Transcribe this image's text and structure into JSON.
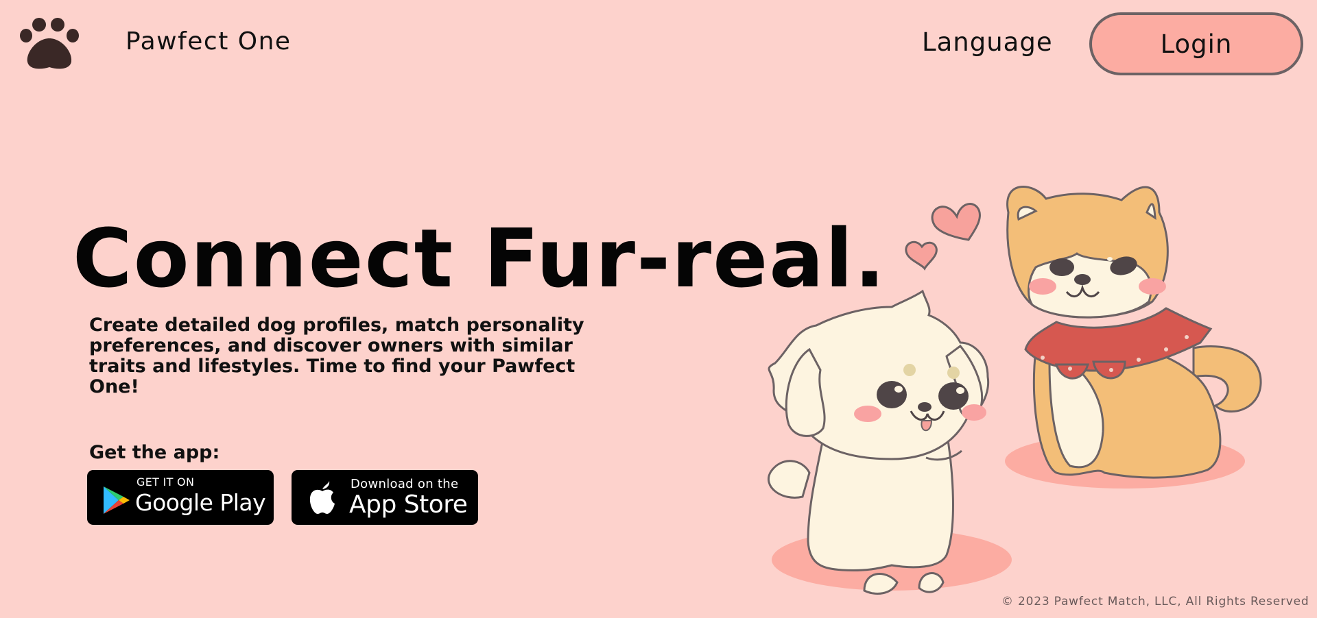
{
  "nav": {
    "brand": "Pawfect One",
    "language": "Language",
    "login": "Login",
    "logo_icon": "paw-icon"
  },
  "hero": {
    "headline": "Connect Fur-real.",
    "description": "Create detailed dog profiles, match personality preferences, and discover owners with similar traits and lifestyles. Time to find your Pawfect One!",
    "get_app": "Get the app:"
  },
  "badges": {
    "google_small": "GET IT ON",
    "google_big": "Google Play",
    "apple_small": "Download on the",
    "apple_big": "App Store"
  },
  "footer": {
    "copyright": "© 2023 Pawfect Match, LLC, All Rights Reserved"
  },
  "colors": {
    "background": "#fdd2cc",
    "login_fill": "#fcaca2",
    "login_border": "#6c6264",
    "text": "#0c0c0c"
  }
}
